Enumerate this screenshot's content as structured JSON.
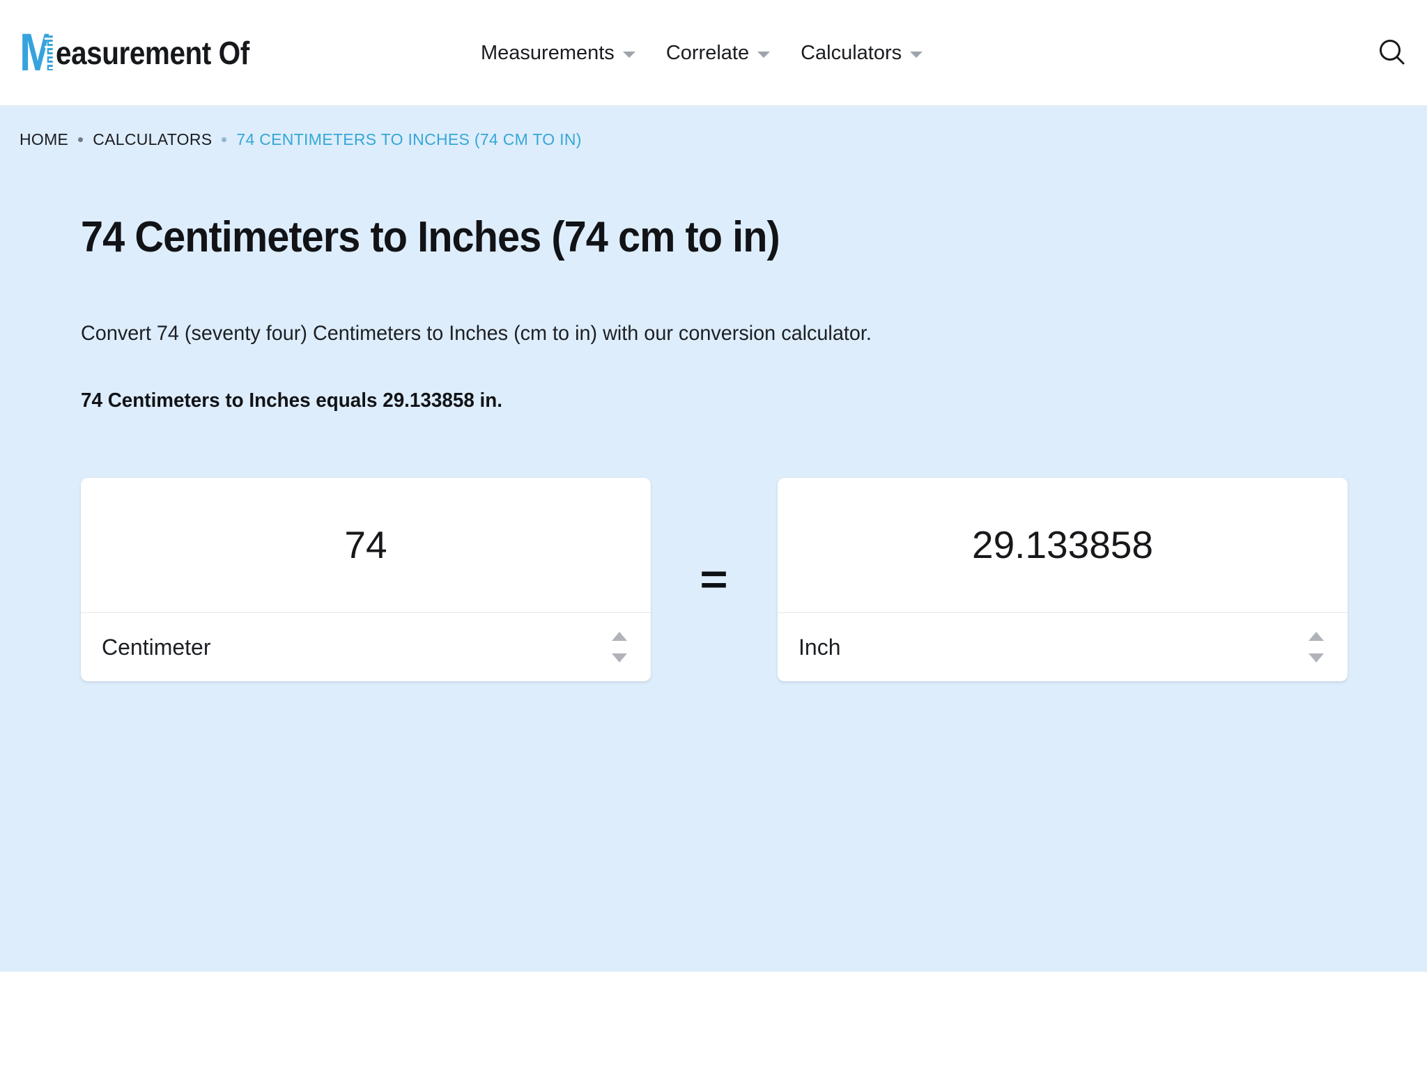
{
  "header": {
    "logo": {
      "mark_letter": "M",
      "text": "easurement Of",
      "mark_color": "#36a3dd",
      "icon": "ruler-m-logo"
    },
    "nav": [
      {
        "label": "Measurements",
        "icon": "chevron-down-icon"
      },
      {
        "label": "Correlate",
        "icon": "chevron-down-icon"
      },
      {
        "label": "Calculators",
        "icon": "chevron-down-icon"
      }
    ],
    "search": {
      "icon": "search-icon",
      "label": "Search"
    }
  },
  "breadcrumb": {
    "items": [
      {
        "label": "HOME",
        "active": false
      },
      {
        "label": "CALCULATORS",
        "active": false
      },
      {
        "label": "74 CENTIMETERS TO INCHES (74 CM TO IN)",
        "active": true
      }
    ],
    "separator": "•",
    "active_color": "#35a7d8"
  },
  "main": {
    "title": "74 Centimeters to Inches (74 cm to in)",
    "intro": "Convert 74 (seventy four) Centimeters to Inches (cm to in) with our conversion calculator.",
    "result_line": "74 Centimeters to Inches equals 29.133858 in."
  },
  "converter": {
    "from": {
      "value": "74",
      "unit": "Centimeter",
      "spinner_icon": "spinner-arrows-icon"
    },
    "operator": "=",
    "to": {
      "value": "29.133858",
      "unit": "Inch",
      "spinner_icon": "spinner-arrows-icon"
    }
  },
  "colors": {
    "hero_background": "#deedfb",
    "accent": "#35a7d8",
    "card_background": "#ffffff",
    "text": "#1a1c20"
  }
}
